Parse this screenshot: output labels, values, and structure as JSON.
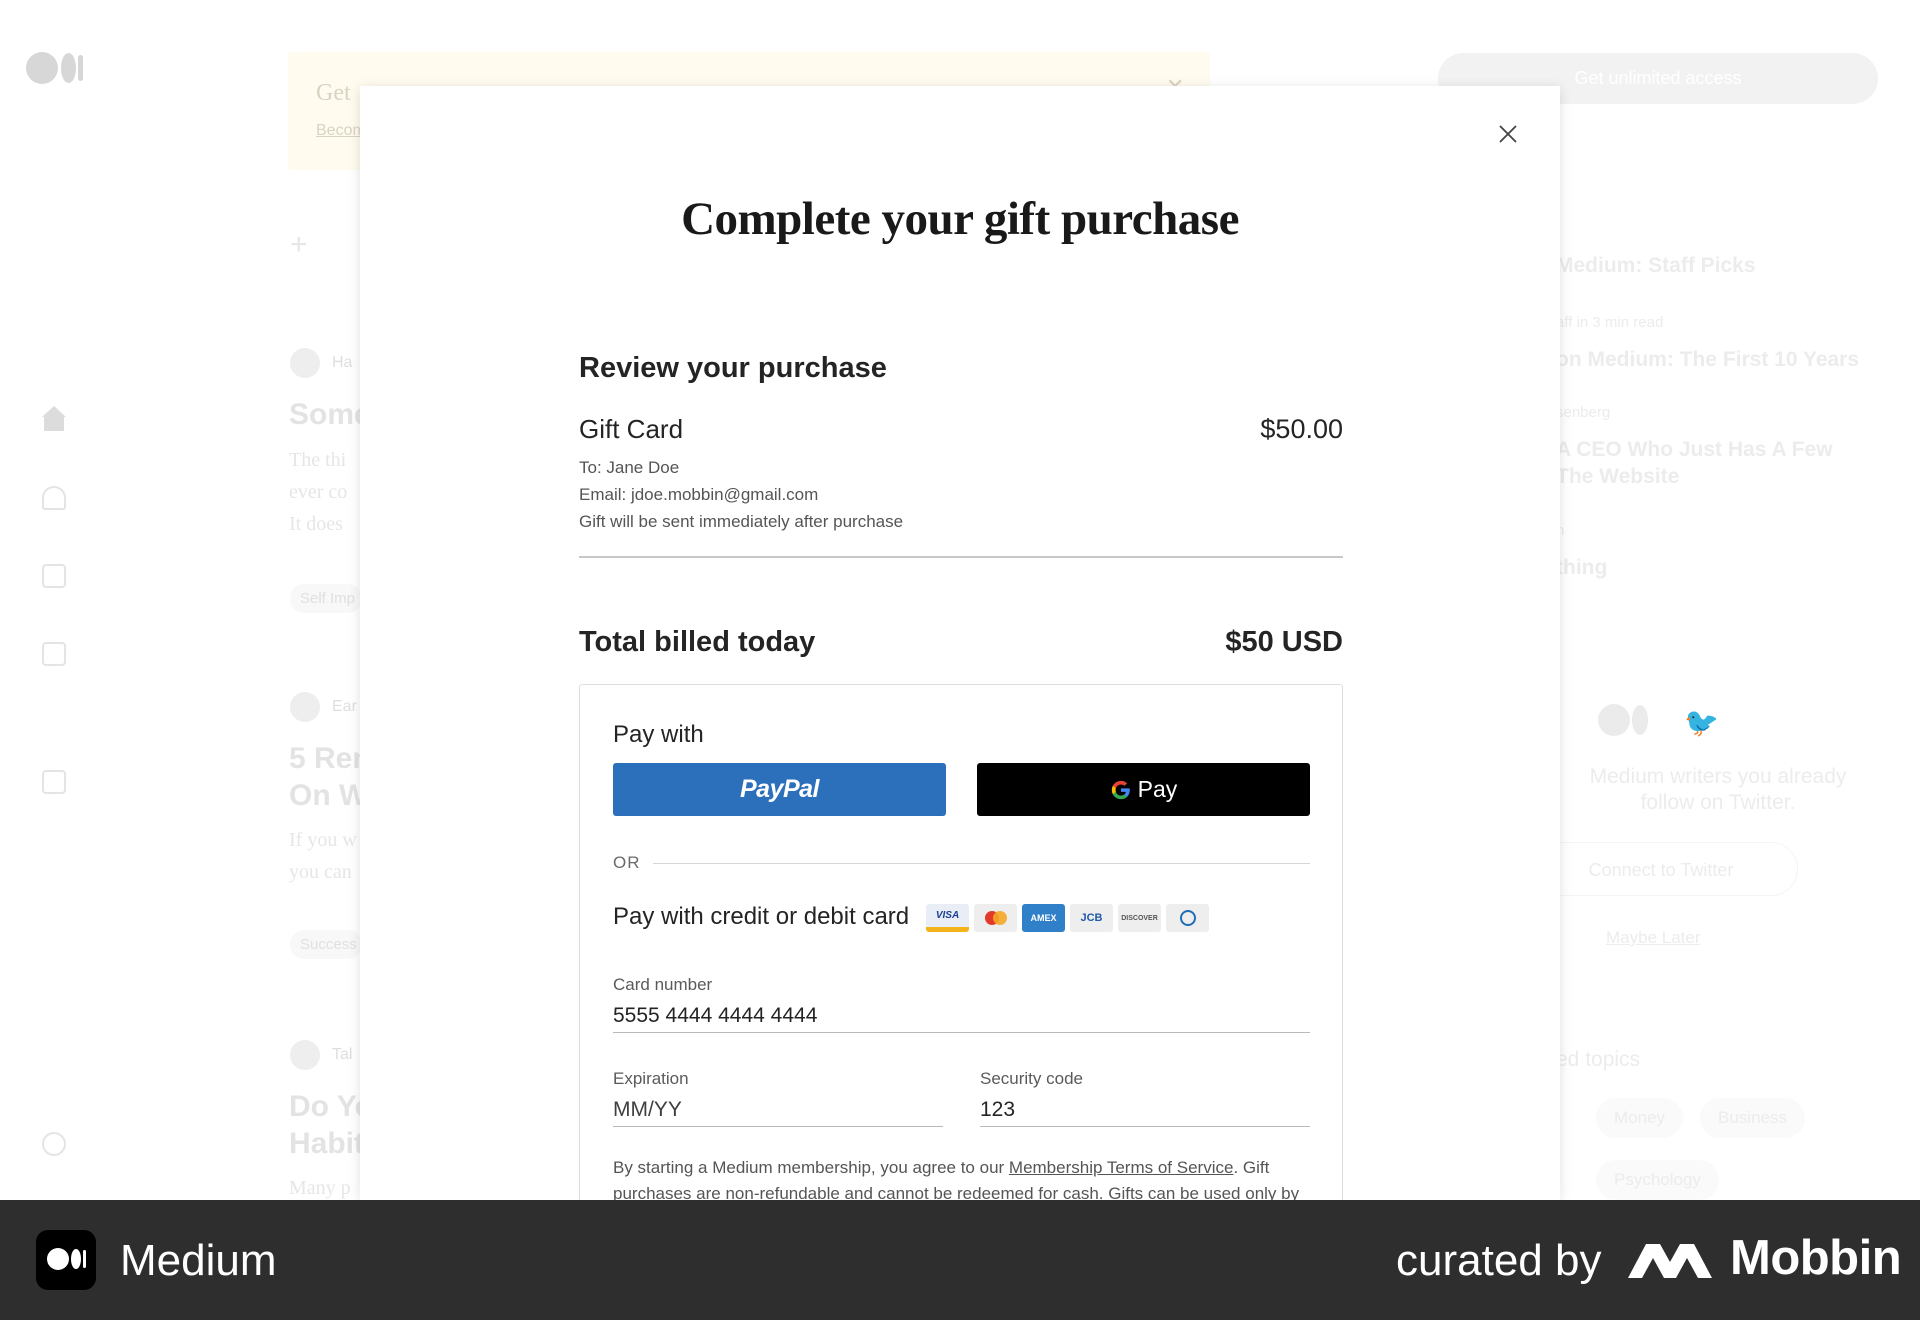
{
  "background": {
    "banner": {
      "title": "Get",
      "link": "Becom"
    },
    "stories": [
      {
        "author": "Ha",
        "title": "Some",
        "body": "The thi\never co\nIt does",
        "tag": "Self Imp"
      },
      {
        "author": "Ear",
        "title": "5 Ren\nOn W",
        "body": "If you w\nyou can",
        "tag": "Success"
      },
      {
        "author": "Tal",
        "title": "Do Yo\nHabit",
        "body": "Many p",
        "tag": ""
      }
    ],
    "cta_label": "Get unlimited access",
    "sidebar": {
      "heading": "Medium: Staff Picks",
      "meta1": "aff in 3 min read",
      "title1": "on Medium: The First 10 Years",
      "meta2": "senberg",
      "title2": "A CEO Who Just Has A Few\nThe Website",
      "meta3": "n",
      "title3": "thing",
      "twitter_text": "Medium writers you already\nfollow on Twitter.",
      "connect_label": "Connect to Twitter",
      "maybe_later": "Maybe Later",
      "topics_heading": "ed topics",
      "topics": [
        "Money",
        "Business",
        "Psychology"
      ]
    }
  },
  "modal": {
    "title": "Complete your gift purchase",
    "review_heading": "Review your purchase",
    "item": {
      "name": "Gift Card",
      "price": "$50.00",
      "to": "To: Jane Doe",
      "email": "Email: jdoe.mobbin@gmail.com",
      "note": "Gift will be sent immediately after purchase"
    },
    "total_label": "Total billed today",
    "total_value": "$50 USD",
    "payment": {
      "pay_with": "Pay with",
      "paypal_label": "PayPal",
      "gpay_label": "Pay",
      "or_label": "OR",
      "card_heading": "Pay with credit or debit card",
      "card_brands": [
        "VISA",
        "Mastercard",
        "AMEX",
        "JCB",
        "DISCOVER",
        "Diners Club"
      ],
      "card_number_label": "Card number",
      "card_number_value": "5555 4444 4444 4444",
      "expiration_label": "Expiration",
      "expiration_placeholder": "MM/YY",
      "security_label": "Security code",
      "security_value": "123",
      "terms_before": "By starting a Medium membership, you agree to our ",
      "terms_link": "Membership Terms of Service",
      "terms_after": ". Gift purchases are non-refundable and cannot be redeemed for cash. Gifts can be used only by"
    }
  },
  "footer": {
    "app_name": "Medium",
    "curated_by": "curated by",
    "brand": "Mobbin"
  },
  "colors": {
    "paypal": "#2c6fba",
    "gpay": "#000000",
    "footer_bg": "#2e2e2e"
  }
}
